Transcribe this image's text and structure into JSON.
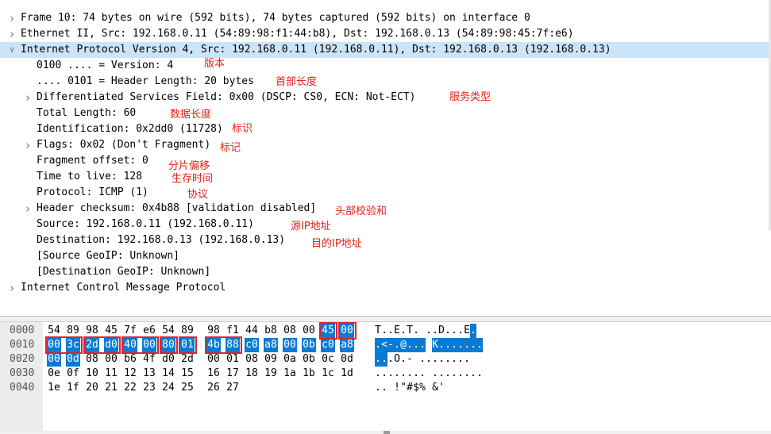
{
  "tree": [
    {
      "id": "frame",
      "arrow": "collapsed",
      "indent": 0,
      "text": "Frame 10: 74 bytes on wire (592 bits), 74 bytes captured (592 bits) on interface 0"
    },
    {
      "id": "ethernet",
      "arrow": "collapsed",
      "indent": 0,
      "text": "Ethernet II, Src: 192.168.0.11 (54:89:98:f1:44:b8), Dst: 192.168.0.13 (54:89:98:45:7f:e6)"
    },
    {
      "id": "ipv4",
      "arrow": "expanded",
      "indent": 0,
      "selected": true,
      "text": "Internet Protocol Version 4, Src: 192.168.0.11 (192.168.0.11), Dst: 192.168.0.13 (192.168.0.13)"
    },
    {
      "id": "version",
      "arrow": "none",
      "indent": 1,
      "text": "0100 .... = Version: 4"
    },
    {
      "id": "header-length",
      "arrow": "none",
      "indent": 1,
      "text": ".... 0101 = Header Length: 20 bytes"
    },
    {
      "id": "dsfield",
      "arrow": "collapsed",
      "indent": 1,
      "text": "Differentiated Services Field: 0x00 (DSCP: CS0, ECN: Not-ECT)"
    },
    {
      "id": "total-length",
      "arrow": "none",
      "indent": 1,
      "text": "Total Length: 60"
    },
    {
      "id": "identification",
      "arrow": "none",
      "indent": 1,
      "text": "Identification: 0x2dd0 (11728)"
    },
    {
      "id": "flags",
      "arrow": "collapsed",
      "indent": 1,
      "text": "Flags: 0x02 (Don't Fragment)"
    },
    {
      "id": "fragment-offset",
      "arrow": "none",
      "indent": 1,
      "text": "Fragment offset: 0"
    },
    {
      "id": "ttl",
      "arrow": "none",
      "indent": 1,
      "text": "Time to live: 128"
    },
    {
      "id": "protocol",
      "arrow": "none",
      "indent": 1,
      "text": "Protocol: ICMP (1)"
    },
    {
      "id": "checksum",
      "arrow": "collapsed",
      "indent": 1,
      "text": "Header checksum: 0x4b88 [validation disabled]"
    },
    {
      "id": "source",
      "arrow": "none",
      "indent": 1,
      "text": "Source: 192.168.0.11 (192.168.0.11)"
    },
    {
      "id": "destination",
      "arrow": "none",
      "indent": 1,
      "text": "Destination: 192.168.0.13 (192.168.0.13)"
    },
    {
      "id": "src-geoip",
      "arrow": "none",
      "indent": 1,
      "text": "[Source GeoIP: Unknown]"
    },
    {
      "id": "dst-geoip",
      "arrow": "none",
      "indent": 1,
      "text": "[Destination GeoIP: Unknown]"
    },
    {
      "id": "icmp",
      "arrow": "collapsed",
      "indent": 0,
      "text": "Internet Control Message Protocol"
    }
  ],
  "annotations": [
    {
      "id": "version",
      "text": "版本"
    },
    {
      "id": "header-length",
      "text": "首部长度"
    },
    {
      "id": "service-type",
      "text": "服务类型"
    },
    {
      "id": "data-length",
      "text": "数据长度"
    },
    {
      "id": "identification",
      "text": "标识"
    },
    {
      "id": "flags",
      "text": "标记"
    },
    {
      "id": "fragment-offset",
      "text": "分片偏移"
    },
    {
      "id": "ttl",
      "text": "生存时间"
    },
    {
      "id": "protocol",
      "text": "协议"
    },
    {
      "id": "checksum",
      "text": "头部校验和"
    },
    {
      "id": "source-ip",
      "text": "源IP地址"
    },
    {
      "id": "dest-ip",
      "text": "目的IP地址"
    }
  ],
  "hex": {
    "offsets": [
      "0000",
      "0010",
      "0020",
      "0030",
      "0040"
    ],
    "rows": [
      [
        "54",
        "89",
        "98",
        "45",
        "7f",
        "e6",
        "54",
        "89",
        "98",
        "f1",
        "44",
        "b8",
        "08",
        "00",
        "45",
        "00"
      ],
      [
        "00",
        "3c",
        "2d",
        "d0",
        "40",
        "00",
        "80",
        "01",
        "4b",
        "88",
        "c0",
        "a8",
        "00",
        "0b",
        "c0",
        "a8"
      ],
      [
        "00",
        "0d",
        "08",
        "00",
        "b6",
        "4f",
        "d0",
        "2d",
        "00",
        "01",
        "08",
        "09",
        "0a",
        "0b",
        "0c",
        "0d"
      ],
      [
        "0e",
        "0f",
        "10",
        "11",
        "12",
        "13",
        "14",
        "15",
        "16",
        "17",
        "18",
        "19",
        "1a",
        "1b",
        "1c",
        "1d"
      ],
      [
        "1e",
        "1f",
        "20",
        "21",
        "22",
        "23",
        "24",
        "25",
        "26",
        "27"
      ]
    ],
    "ascii": [
      "T..E.T. ..D...E.",
      ".<-.@... K.......",
      "...O.- ........",
      "........ ........",
      ".. !\"#$% &'"
    ],
    "highlight_start": 14,
    "highlight_end": 33
  },
  "colors": {
    "selection_row": "#cce4f7",
    "highlight": "#0a7bd4",
    "annotation": "#e2231a",
    "box": "#e0222a"
  }
}
